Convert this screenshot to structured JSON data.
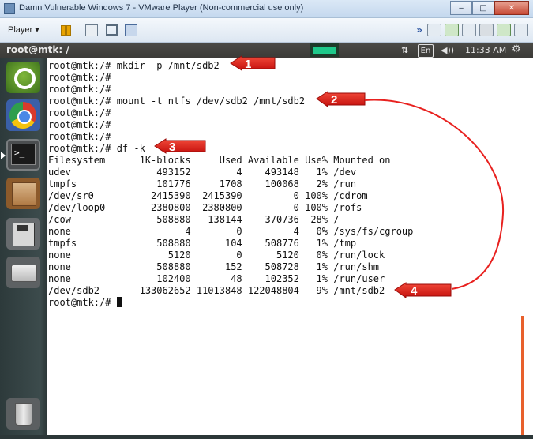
{
  "window": {
    "title": "Damn Vulnerable Windows 7 - VMware Player (Non-commercial use only)",
    "minimize_glyph": "‒",
    "maximize_glyph": "□",
    "close_glyph": "✕"
  },
  "toolbar": {
    "player_menu": "Player ▾",
    "overflow_glyph": "»"
  },
  "ubuntu_panel": {
    "window_title": "root@mtk: /",
    "sort_glyph": "⇅",
    "language": "En",
    "volume_glyph": "◀))",
    "clock": "11:33 AM",
    "settings_glyph": "⚙"
  },
  "launcher": {
    "items": [
      "ubuntu-dash",
      "chromium",
      "terminal",
      "files",
      "save",
      "disk",
      "trash"
    ],
    "terminal_label": ">_"
  },
  "terminal": {
    "lines": [
      "root@mtk:/# mkdir -p /mnt/sdb2",
      "root@mtk:/#",
      "root@mtk:/#",
      "root@mtk:/# mount -t ntfs /dev/sdb2 /mnt/sdb2",
      "root@mtk:/#",
      "root@mtk:/#",
      "root@mtk:/#",
      "root@mtk:/# df -k",
      "Filesystem      1K-blocks     Used Available Use% Mounted on",
      "udev               493152        4    493148   1% /dev",
      "tmpfs              101776     1708    100068   2% /run",
      "/dev/sr0          2415390  2415390         0 100% /cdrom",
      "/dev/loop0        2380800  2380800         0 100% /rofs",
      "/cow               508880   138144    370736  28% /",
      "none                    4        0         4   0% /sys/fs/cgroup",
      "tmpfs              508880      104    508776   1% /tmp",
      "none                 5120        0      5120   0% /run/lock",
      "none               508880      152    508728   1% /run/shm",
      "none               102400       48    102352   1% /run/user",
      "/dev/sdb2       133062652 11013848 122048804   9% /mnt/sdb2"
    ],
    "prompt": "root@mtk:/# "
  },
  "annotations": {
    "color": "#e8211f",
    "badges": [
      "1",
      "2",
      "3",
      "4"
    ]
  }
}
